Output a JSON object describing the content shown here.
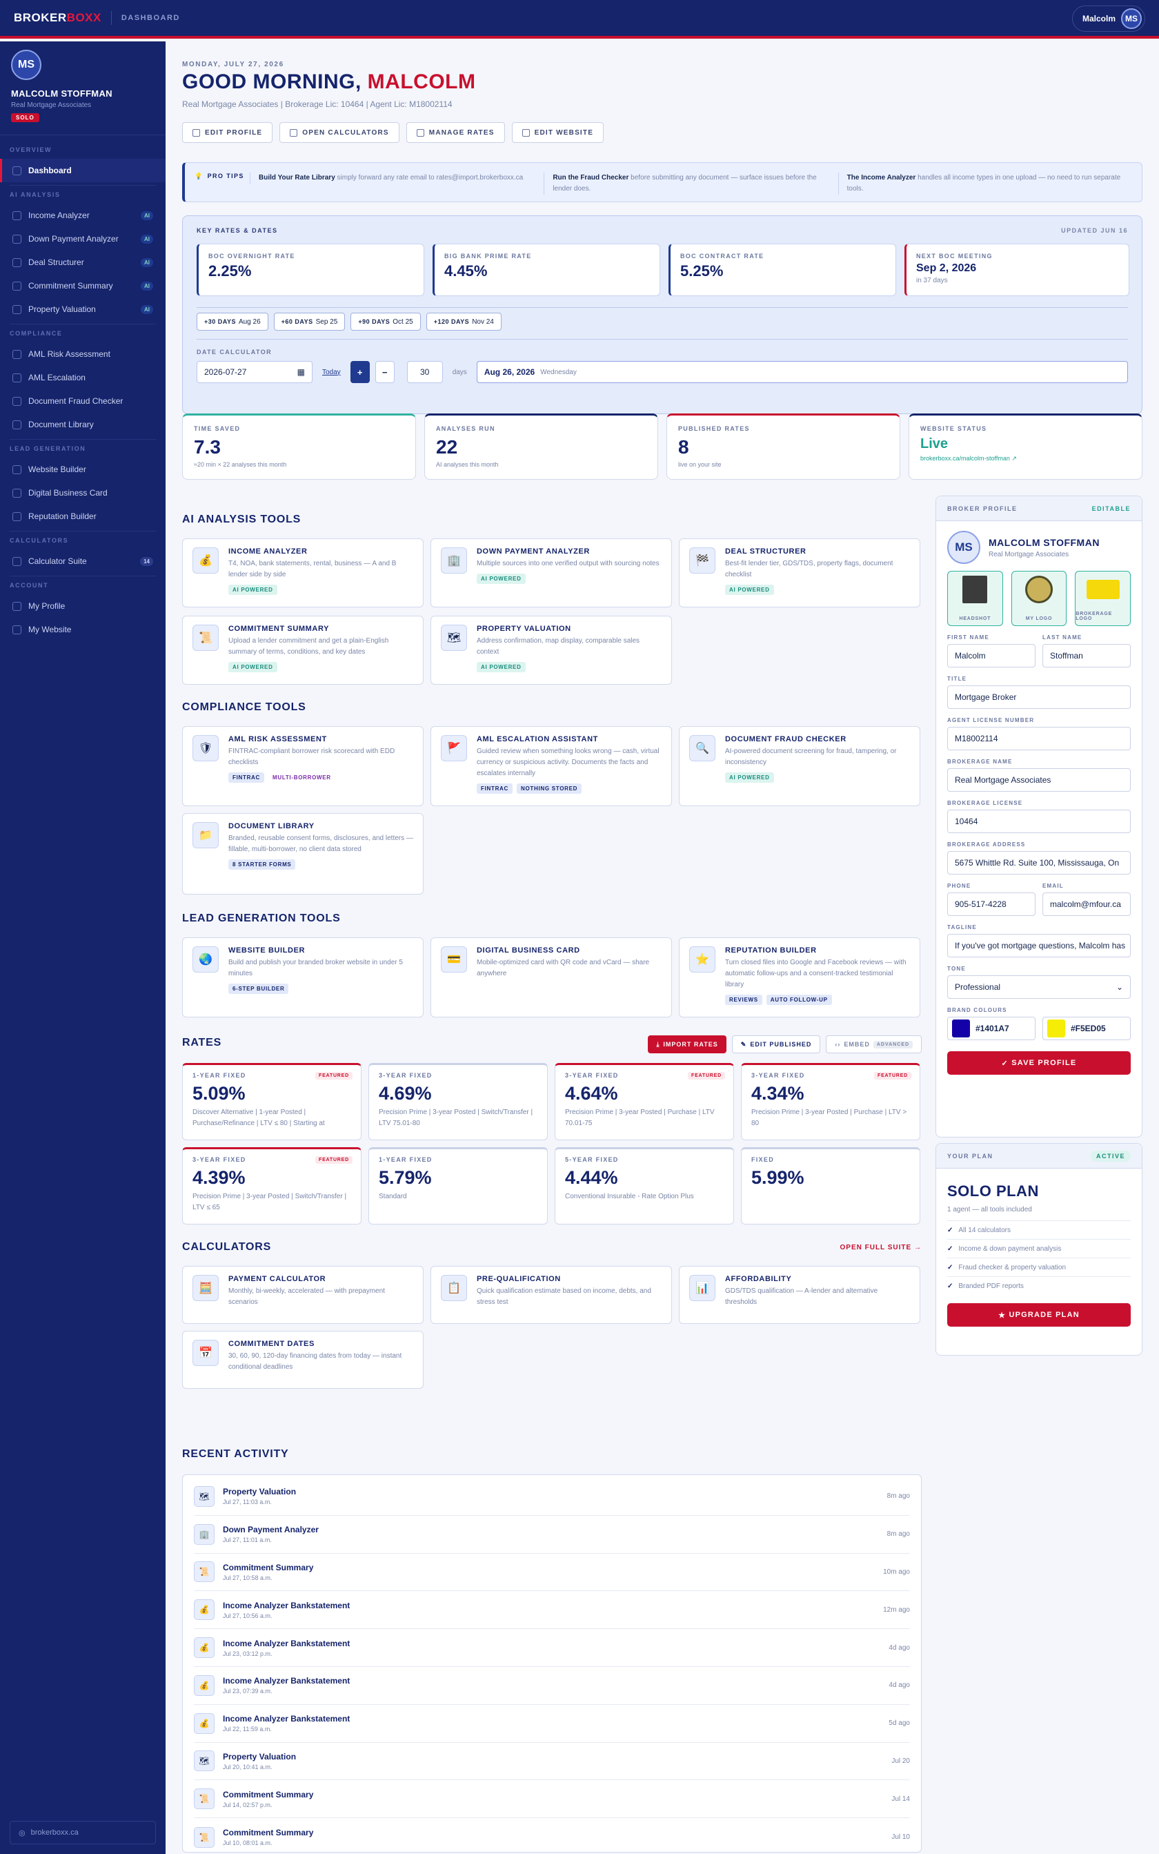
{
  "topbar": {
    "logo_a": "BROKER",
    "logo_b": "BOXX",
    "crumb": "DASHBOARD",
    "user": "Malcolm",
    "initials": "MS"
  },
  "sidebar": {
    "initials": "MS",
    "name": "MALCOLM STOFFMAN",
    "company": "Real Mortgage Associates",
    "badge": "SOLO",
    "sections": {
      "overview": "OVERVIEW",
      "ai": "AI ANALYSIS",
      "compliance": "COMPLIANCE",
      "leadgen": "LEAD GENERATION",
      "calculators": "CALCULATORS",
      "account": "ACCOUNT"
    },
    "items": {
      "dashboard": "Dashboard",
      "income": "Income Analyzer",
      "downpayment": "Down Payment Analyzer",
      "deal": "Deal Structurer",
      "commitment": "Commitment Summary",
      "property": "Property Valuation",
      "aml": "AML Risk Assessment",
      "escalation": "AML Escalation",
      "fraud": "Document Fraud Checker",
      "library": "Document Library",
      "website": "Website Builder",
      "card": "Digital Business Card",
      "reputation": "Reputation Builder",
      "calcsuite": "Calculator Suite",
      "profile": "My Profile",
      "mywebsite": "My Website"
    },
    "ai_tag": "AI",
    "calc_count": "14",
    "footer": "brokerboxx.ca"
  },
  "header": {
    "date": "MONDAY, JULY 27, 2026",
    "greet_a": "GOOD MORNING, ",
    "greet_b": "MALCOLM",
    "meta": "Real Mortgage Associates | Brokerage Lic: 10464 | Agent Lic: M18002114",
    "actions": [
      "EDIT PROFILE",
      "OPEN CALCULATORS",
      "MANAGE RATES",
      "EDIT WEBSITE"
    ]
  },
  "tips": {
    "label": "PRO TIPS",
    "items": [
      {
        "bold": "Build Your Rate Library",
        "text": " simply forward any rate email to rates@import.brokerboxx.ca"
      },
      {
        "bold": "Run the Fraud Checker",
        "text": " before submitting any document — surface issues before the lender does."
      },
      {
        "bold": "The Income Analyzer",
        "text": " handles all income types in one upload — no need to run separate tools."
      }
    ]
  },
  "keyrates": {
    "title": "KEY RATES & DATES",
    "updated": "UPDATED JUN 16",
    "boxes": [
      {
        "label": "BOC OVERNIGHT RATE",
        "value": "2.25%"
      },
      {
        "label": "BIG BANK PRIME RATE",
        "value": "4.45%"
      },
      {
        "label": "BOC CONTRACT RATE",
        "value": "5.25%"
      },
      {
        "label": "NEXT BOC MEETING",
        "value": "Sep 2, 2026",
        "sub": "in 37 days"
      }
    ],
    "chips": [
      {
        "k": "+30 DAYS",
        "v": "Aug 26"
      },
      {
        "k": "+60 DAYS",
        "v": "Sep 25"
      },
      {
        "k": "+90 DAYS",
        "v": "Oct 25"
      },
      {
        "k": "+120 DAYS",
        "v": "Nov 24"
      }
    ],
    "calc_label": "DATE CALCULATOR",
    "date_in": "2026-07-27",
    "today": "Today",
    "plus": "+",
    "minus": "−",
    "days_val": "30",
    "days_lbl": "days",
    "result": "Aug 26, 2026",
    "result_day": "Wednesday"
  },
  "stats": [
    {
      "label": "TIME SAVED",
      "value": "7.3",
      "sub": "≈20 min × 22 analyses this month"
    },
    {
      "label": "ANALYSES RUN",
      "value": "22",
      "sub": "AI analyses this month"
    },
    {
      "label": "PUBLISHED RATES",
      "value": "8",
      "sub": "live on your site"
    },
    {
      "label": "WEBSITE STATUS",
      "value": "Live",
      "sub": "brokerboxx.ca/malcolm-stoffman ↗"
    }
  ],
  "sections": {
    "ai": "AI ANALYSIS TOOLS",
    "compliance": "COMPLIANCE TOOLS",
    "leadgen": "LEAD GENERATION TOOLS",
    "rates": "RATES",
    "calculators": "CALCULATORS",
    "activity": "RECENT ACTIVITY"
  },
  "ai_tools": [
    {
      "icon": "💰",
      "title": "INCOME ANALYZER",
      "desc": "T4, NOA, bank statements, rental, business — A and B lender side by side",
      "tags": [
        "AI POWERED"
      ]
    },
    {
      "icon": "🏢",
      "title": "DOWN PAYMENT ANALYZER",
      "desc": "Multiple sources into one verified output with sourcing notes",
      "tags": [
        "AI POWERED"
      ]
    },
    {
      "icon": "🏁",
      "title": "DEAL STRUCTURER",
      "desc": "Best-fit lender tier, GDS/TDS, property flags, document checklist",
      "tags": [
        "AI POWERED"
      ]
    },
    {
      "icon": "📜",
      "title": "COMMITMENT SUMMARY",
      "desc": "Upload a lender commitment and get a plain-English summary of terms, conditions, and key dates",
      "tags": [
        "AI POWERED"
      ]
    },
    {
      "icon": "🗺",
      "title": "PROPERTY VALUATION",
      "desc": "Address confirmation, map display, comparable sales context",
      "tags": [
        "AI POWERED"
      ]
    }
  ],
  "compliance_tools": [
    {
      "icon": "🛡",
      "title": "AML RISK ASSESSMENT",
      "desc": "FINTRAC-compliant borrower risk scorecard with EDD checklists",
      "tags": [
        "FINTRAC",
        "MULTI-BORROWER"
      ]
    },
    {
      "icon": "🚩",
      "title": "AML ESCALATION ASSISTANT",
      "desc": "Guided review when something looks wrong — cash, virtual currency or suspicious activity. Documents the facts and escalates internally",
      "tags": [
        "FINTRAC",
        "NOTHING STORED"
      ]
    },
    {
      "icon": "🔍",
      "title": "DOCUMENT FRAUD CHECKER",
      "desc": "AI-powered document screening for fraud, tampering, or inconsistency",
      "tags": [
        "AI POWERED"
      ]
    },
    {
      "icon": "📁",
      "title": "DOCUMENT LIBRARY",
      "desc": "Branded, reusable consent forms, disclosures, and letters — fillable, multi-borrower, no client data stored",
      "tags": [
        "8 STARTER FORMS"
      ]
    }
  ],
  "lead_tools": [
    {
      "icon": "🌏",
      "title": "WEBSITE BUILDER",
      "desc": "Build and publish your branded broker website in under 5 minutes",
      "tags": [
        "6-STEP BUILDER"
      ]
    },
    {
      "icon": "💳",
      "title": "DIGITAL BUSINESS CARD",
      "desc": "Mobile-optimized card with QR code and vCard — share anywhere",
      "tags": []
    },
    {
      "icon": "⭐",
      "title": "REPUTATION BUILDER",
      "desc": "Turn closed files into Google and Facebook reviews — with automatic follow-ups and a consent-tracked testimonial library",
      "tags": [
        "REVIEWS",
        "AUTO FOLLOW-UP"
      ]
    }
  ],
  "rate_buttons": {
    "import": "IMPORT RATES",
    "edit": "EDIT PUBLISHED",
    "embed": "EMBED",
    "advanced": "ADVANCED"
  },
  "featured_label": "FEATURED",
  "rates": [
    {
      "term": "1-YEAR FIXED",
      "value": "5.09%",
      "desc": "Discover Alternative | 1-year Posted | Purchase/Refinance | LTV ≤ 80 | Starting at",
      "featured": true
    },
    {
      "term": "3-YEAR FIXED",
      "value": "4.69%",
      "desc": "Precision Prime | 3-year Posted | Switch/Transfer | LTV 75.01-80",
      "featured": false
    },
    {
      "term": "3-YEAR FIXED",
      "value": "4.64%",
      "desc": "Precision Prime | 3-year Posted | Purchase | LTV 70.01-75",
      "featured": true
    },
    {
      "term": "3-YEAR FIXED",
      "value": "4.34%",
      "desc": "Precision Prime | 3-year Posted | Purchase | LTV > 80",
      "featured": true
    },
    {
      "term": "3-YEAR FIXED",
      "value": "4.39%",
      "desc": "Precision Prime | 3-year Posted | Switch/Transfer | LTV ≤ 65",
      "featured": true
    },
    {
      "term": "1-YEAR FIXED",
      "value": "5.79%",
      "desc": "Standard",
      "featured": false
    },
    {
      "term": "5-YEAR FIXED",
      "value": "4.44%",
      "desc": "Conventional Insurable - Rate Option Plus",
      "featured": false
    },
    {
      "term": "FIXED",
      "value": "5.99%",
      "desc": "",
      "featured": false
    }
  ],
  "open_suite": "OPEN FULL SUITE →",
  "calculators": [
    {
      "icon": "🧮",
      "title": "PAYMENT CALCULATOR",
      "desc": "Monthly, bi-weekly, accelerated — with prepayment scenarios"
    },
    {
      "icon": "📋",
      "title": "PRE-QUALIFICATION",
      "desc": "Quick qualification estimate based on income, debts, and stress test"
    },
    {
      "icon": "📊",
      "title": "AFFORDABILITY",
      "desc": "GDS/TDS qualification — A-lender and alternative thresholds"
    },
    {
      "icon": "📅",
      "title": "COMMITMENT DATES",
      "desc": "30, 60, 90, 120-day financing dates from today — instant conditional deadlines"
    }
  ],
  "activity": [
    {
      "icon": "🗺",
      "title": "Property Valuation",
      "date": "Jul 27, 11:03 a.m.",
      "ago": "8m ago"
    },
    {
      "icon": "🏢",
      "title": "Down Payment Analyzer",
      "date": "Jul 27, 11:01 a.m.",
      "ago": "8m ago"
    },
    {
      "icon": "📜",
      "title": "Commitment Summary",
      "date": "Jul 27, 10:58 a.m.",
      "ago": "10m ago"
    },
    {
      "icon": "💰",
      "title": "Income Analyzer Bankstatement",
      "date": "Jul 27, 10:56 a.m.",
      "ago": "12m ago"
    },
    {
      "icon": "💰",
      "title": "Income Analyzer Bankstatement",
      "date": "Jul 23, 03:12 p.m.",
      "ago": "4d ago"
    },
    {
      "icon": "💰",
      "title": "Income Analyzer Bankstatement",
      "date": "Jul 23, 07:39 a.m.",
      "ago": "4d ago"
    },
    {
      "icon": "💰",
      "title": "Income Analyzer Bankstatement",
      "date": "Jul 22, 11:59 a.m.",
      "ago": "5d ago"
    },
    {
      "icon": "🗺",
      "title": "Property Valuation",
      "date": "Jul 20, 10:41 a.m.",
      "ago": "Jul 20"
    },
    {
      "icon": "📜",
      "title": "Commitment Summary",
      "date": "Jul 14, 02:57 p.m.",
      "ago": "Jul 14"
    },
    {
      "icon": "📜",
      "title": "Commitment Summary",
      "date": "Jul 10, 08:01 a.m.",
      "ago": "Jul 10"
    }
  ],
  "profile": {
    "header": "BROKER PROFILE",
    "editable": "EDITABLE",
    "initials": "MS",
    "name": "MALCOLM STOFFMAN",
    "company": "Real Mortgage Associates",
    "thumbs": [
      "HEADSHOT",
      "MY LOGO",
      "BROKERAGE LOGO"
    ],
    "labels": {
      "first": "FIRST NAME",
      "last": "LAST NAME",
      "title": "TITLE",
      "license": "AGENT LICENSE NUMBER",
      "brokerage": "BROKERAGE NAME",
      "blicense": "BROKERAGE LICENSE",
      "address": "BROKERAGE ADDRESS",
      "phone": "PHONE",
      "email": "EMAIL",
      "tagline": "TAGLINE",
      "tone": "TONE",
      "colours": "BRAND COLOURS"
    },
    "values": {
      "first": "Malcolm",
      "last": "Stoffman",
      "title": "Mortgage Broker",
      "license": "M18002114",
      "brokerage": "Real Mortgage Associates",
      "blicense": "10464",
      "address": "5675 Whittle Rd. Suite 100,  Mississauga, On",
      "phone": "905-517-4228",
      "email": "malcolm@mfour.ca",
      "tagline": "If you've got mortgage questions, Malcolm has",
      "tone": "Professional"
    },
    "colour1": "#1401A7",
    "colour2": "#F5ED05",
    "save": "SAVE PROFILE"
  },
  "plan": {
    "header": "YOUR PLAN",
    "status": "ACTIVE",
    "name": "SOLO PLAN",
    "sub": "1 agent — all tools included",
    "features": [
      "All 14 calculators",
      "Income & down payment analysis",
      "Fraud checker & property valuation",
      "Branded PDF reports"
    ],
    "upgrade": "UPGRADE PLAN"
  }
}
